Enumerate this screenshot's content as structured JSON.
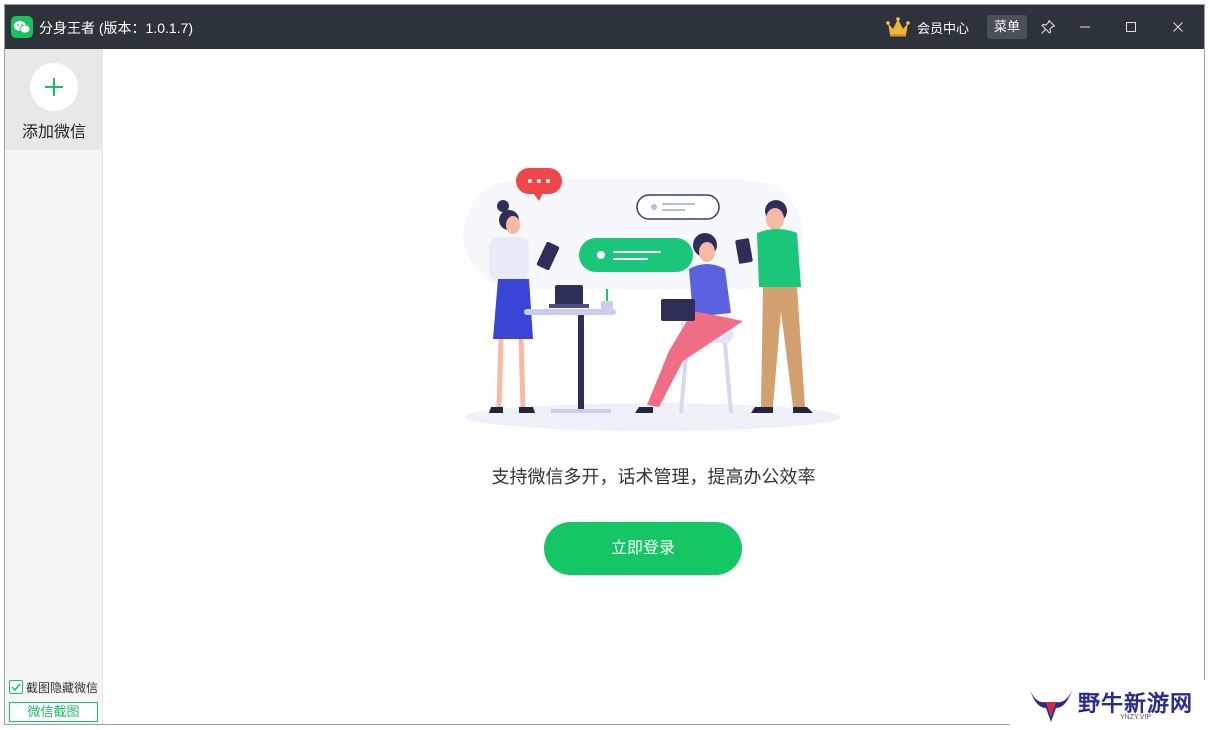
{
  "titlebar": {
    "title": "分身王者 (版本：1.0.1.7)",
    "member_label": "会员中心",
    "menu_label": "菜单",
    "icons": [
      "app-logo-icon",
      "crown-icon",
      "pin-icon",
      "minimize-icon",
      "maximize-icon",
      "close-icon"
    ]
  },
  "sidebar": {
    "add_label": "添加微信",
    "hide_checkbox_label": "截图隐藏微信",
    "hide_checkbox_checked": true,
    "screenshot_button_label": "微信截图"
  },
  "main": {
    "tagline": "支持微信多开，话术管理，提高办公效率",
    "login_button_label": "立即登录"
  },
  "watermark": {
    "text": "野牛新游网",
    "sub": "YNZY.VIP"
  },
  "colors": {
    "titlebar_bg": "#2d333b",
    "accent_green": "#15c664",
    "sidebar_bg": "#f5f5f5"
  }
}
